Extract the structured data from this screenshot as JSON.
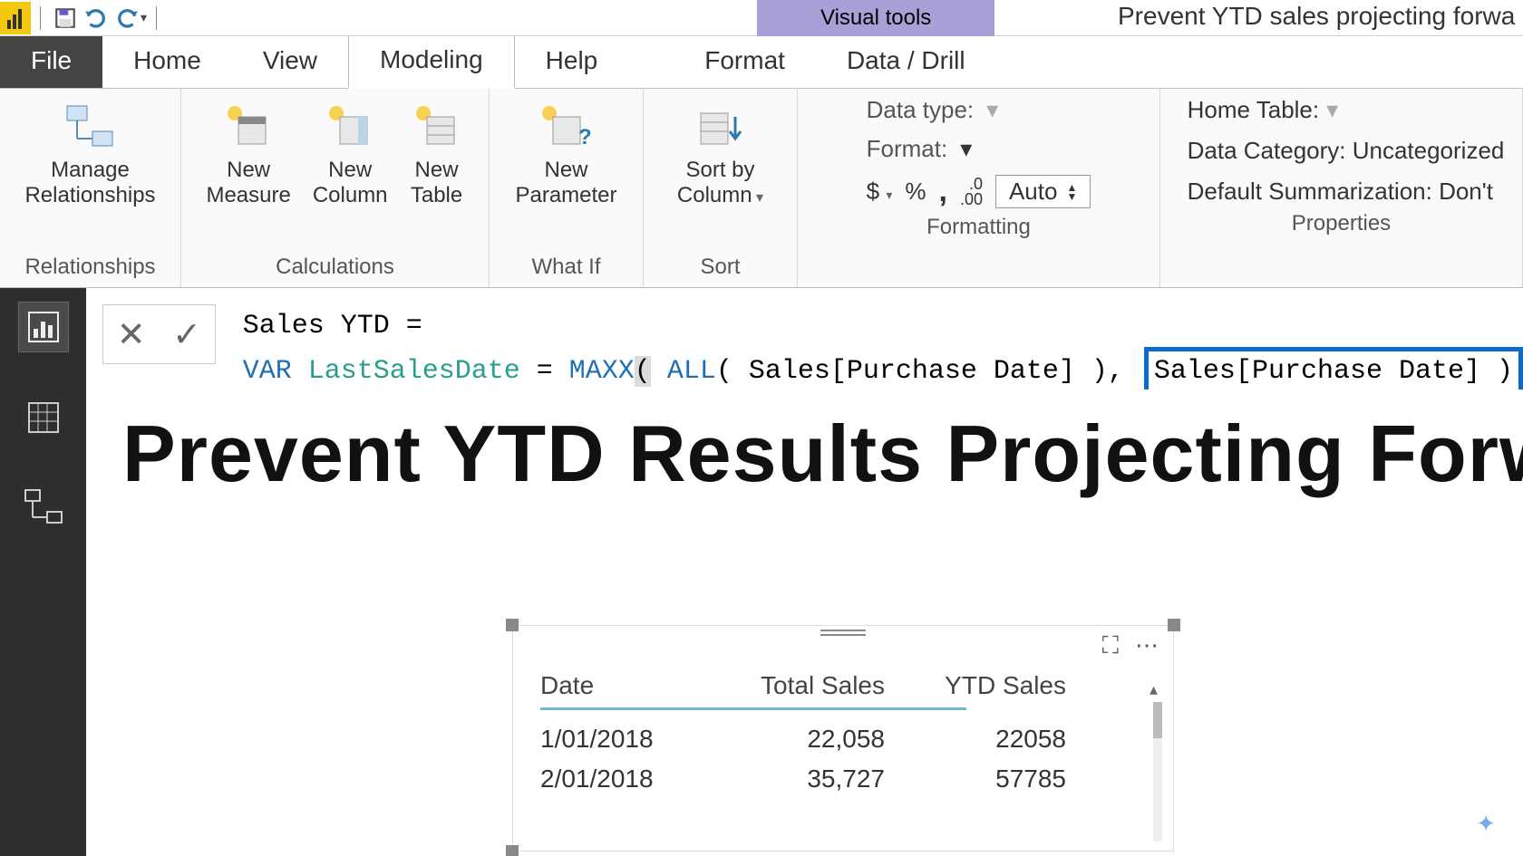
{
  "titlebar": {
    "contextual_tab": "Visual tools",
    "window_title": "Prevent YTD sales projecting forwa"
  },
  "tabs": {
    "file": "File",
    "home": "Home",
    "view": "View",
    "modeling": "Modeling",
    "help": "Help",
    "format": "Format",
    "data_drill": "Data / Drill"
  },
  "ribbon": {
    "relationships": {
      "manage": "Manage\nRelationships",
      "group": "Relationships"
    },
    "calculations": {
      "measure": "New\nMeasure",
      "column": "New\nColumn",
      "table": "New\nTable",
      "group": "Calculations"
    },
    "whatif": {
      "parameter": "New\nParameter",
      "group": "What If"
    },
    "sort": {
      "sortby": "Sort by\nColumn",
      "group": "Sort"
    },
    "formatting": {
      "datatype_label": "Data type:",
      "format_label": "Format:",
      "currency": "$",
      "percent": "%",
      "comma": ",",
      "decimals_icon": ".00",
      "auto": "Auto",
      "group": "Formatting"
    },
    "properties": {
      "home_table": "Home Table:",
      "data_category": "Data Category: Uncategorized",
      "default_summarization": "Default Summarization: Don't",
      "group": "Properties"
    }
  },
  "formula": {
    "line1_name": "Sales YTD",
    "eq": " = ",
    "var_kw": "VAR",
    "var_name": " LastSalesDate ",
    "maxx": "MAXX",
    "all": "ALL",
    "col_ref": "Sales[Purchase Date]",
    "expr2": "Sales[Purchase Date] )"
  },
  "canvas": {
    "title": "Prevent YTD Results Projecting Forw"
  },
  "table": {
    "headers": [
      "Date",
      "Total Sales",
      "YTD Sales"
    ],
    "rows": [
      {
        "date": "1/01/2018",
        "total": "22,058",
        "ytd": "22058"
      },
      {
        "date": "2/01/2018",
        "total": "35,727",
        "ytd": "57785"
      }
    ]
  }
}
